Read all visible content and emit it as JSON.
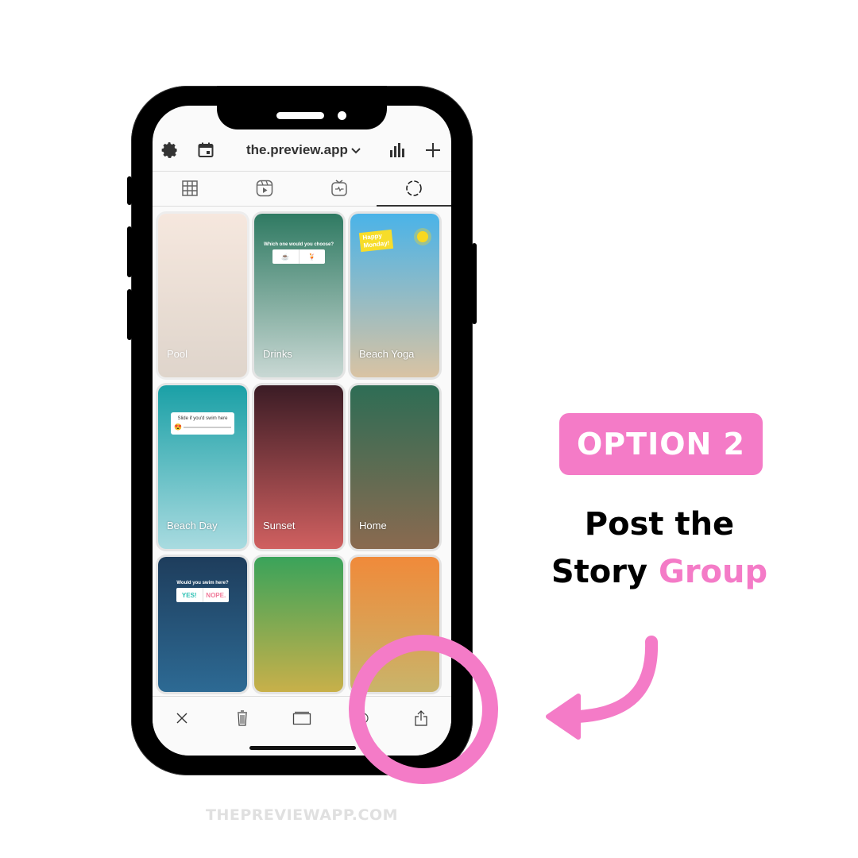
{
  "app": {
    "account_name": "the.preview.app",
    "header_icons": [
      "gear-icon",
      "calendar-icon",
      "chevron-down-icon",
      "bar-chart-icon",
      "plus-icon"
    ]
  },
  "tabs": [
    {
      "name": "grid",
      "icon": "grid-icon",
      "active": false
    },
    {
      "name": "reels",
      "icon": "reels-icon",
      "active": false
    },
    {
      "name": "igtv",
      "icon": "igtv-icon",
      "active": false
    },
    {
      "name": "stories",
      "icon": "stories-circle-icon",
      "active": true
    }
  ],
  "stories": [
    {
      "label": "Pool",
      "selected": false,
      "colors": [
        "#f3d9c8",
        "#c9b7a6"
      ]
    },
    {
      "label": "Drinks",
      "selected": true,
      "colors": [
        "#2f7a62",
        "#c9d8d4"
      ],
      "sticker": {
        "question": "Which one would you choose?",
        "options": [
          "☕",
          "🍹"
        ]
      }
    },
    {
      "label": "Beach Yoga",
      "selected": true,
      "colors": [
        "#4ab3e8",
        "#d9c3a3"
      ],
      "sticker": {
        "text_line1": "Happy",
        "text_line2": "Monday!"
      }
    },
    {
      "label": "Beach Day",
      "selected": true,
      "colors": [
        "#1aa0a6",
        "#a9dbe0"
      ],
      "sticker": {
        "question": "Slide if you'd swim here",
        "emoji": "😍"
      }
    },
    {
      "label": "Sunset",
      "selected": true,
      "colors": [
        "#3b1c25",
        "#d06060"
      ]
    },
    {
      "label": "Home",
      "selected": true,
      "colors": [
        "#2e6d55",
        "#8a6a50"
      ]
    },
    {
      "label": "",
      "selected": true,
      "colors": [
        "#1e3d5c",
        "#2d6a94"
      ],
      "sticker": {
        "question": "Would you swim here?",
        "options": [
          "YES!",
          "NOPE."
        ]
      }
    },
    {
      "label": "",
      "selected": true,
      "colors": [
        "#3aa35a",
        "#c8b04a"
      ]
    },
    {
      "label": "",
      "selected": true,
      "colors": [
        "#f08a3a",
        "#c9b46a"
      ]
    }
  ],
  "bottom_toolbar": [
    {
      "name": "close",
      "icon": "close-icon"
    },
    {
      "name": "delete",
      "icon": "trash-icon"
    },
    {
      "name": "group",
      "icon": "folder-icon"
    },
    {
      "name": "highlight",
      "icon": "circle-icon"
    },
    {
      "name": "share",
      "icon": "share-icon"
    }
  ],
  "callout": {
    "badge": "OPTION 2",
    "line1": "Post the",
    "line2_plain": "Story ",
    "line2_accent": "Group",
    "accent_color": "#f47bc7"
  },
  "footer": "THEPREVIEWAPP.COM"
}
